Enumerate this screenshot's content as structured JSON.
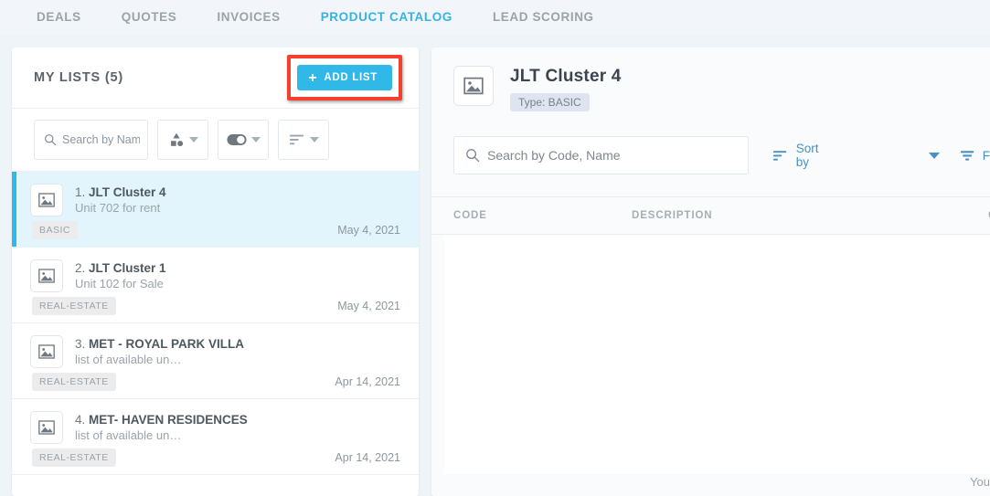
{
  "nav": {
    "tabs": [
      {
        "label": "DEALS",
        "active": false
      },
      {
        "label": "QUOTES",
        "active": false
      },
      {
        "label": "INVOICES",
        "active": false
      },
      {
        "label": "PRODUCT CATALOG",
        "active": true
      },
      {
        "label": "LEAD SCORING",
        "active": false
      }
    ]
  },
  "colors": {
    "accent": "#2fb8e8",
    "active_tab": "#34b3e4",
    "highlight_box": "#f4402e",
    "selected_row_bg": "#e2f5fc",
    "page_bg": "#eff4f9",
    "link_blue": "#4a90c4"
  },
  "left_panel": {
    "title": "MY LISTS (5)",
    "add_button": {
      "label": "ADD LIST",
      "plus": "+",
      "highlighted": true
    },
    "filters": {
      "search_placeholder": "Search by Name",
      "search_value": "",
      "shape_filter_label": "",
      "toggle_filter_label": "",
      "sort_filter_label": ""
    },
    "items": [
      {
        "index": "1.",
        "name": "JLT Cluster 4",
        "subtitle": "Unit 702 for rent",
        "badge": "BASIC",
        "date": "May 4, 2021",
        "selected": true
      },
      {
        "index": "2.",
        "name": "JLT Cluster 1",
        "subtitle": "Unit 102 for Sale",
        "badge": "REAL-ESTATE",
        "date": "May 4, 2021",
        "selected": false
      },
      {
        "index": "3.",
        "name": "MET - ROYAL PARK VILLA",
        "subtitle": "list of available un…",
        "badge": "REAL-ESTATE",
        "date": "Apr 14, 2021",
        "selected": false
      },
      {
        "index": "4.",
        "name": "MET- HAVEN RESIDENCES",
        "subtitle": "list of available un…",
        "badge": "REAL-ESTATE",
        "date": "Apr 14, 2021",
        "selected": false
      }
    ]
  },
  "right_panel": {
    "title": "JLT Cluster 4",
    "type_badge": "Type: BASIC",
    "search_placeholder": "Search by Code, Name",
    "search_value": "",
    "sort_by_label": "Sort by",
    "filter_by_label": "F",
    "table": {
      "columns": [
        "CODE",
        "DESCRIPTION",
        "CR"
      ],
      "rows": []
    },
    "footnote": "You"
  }
}
